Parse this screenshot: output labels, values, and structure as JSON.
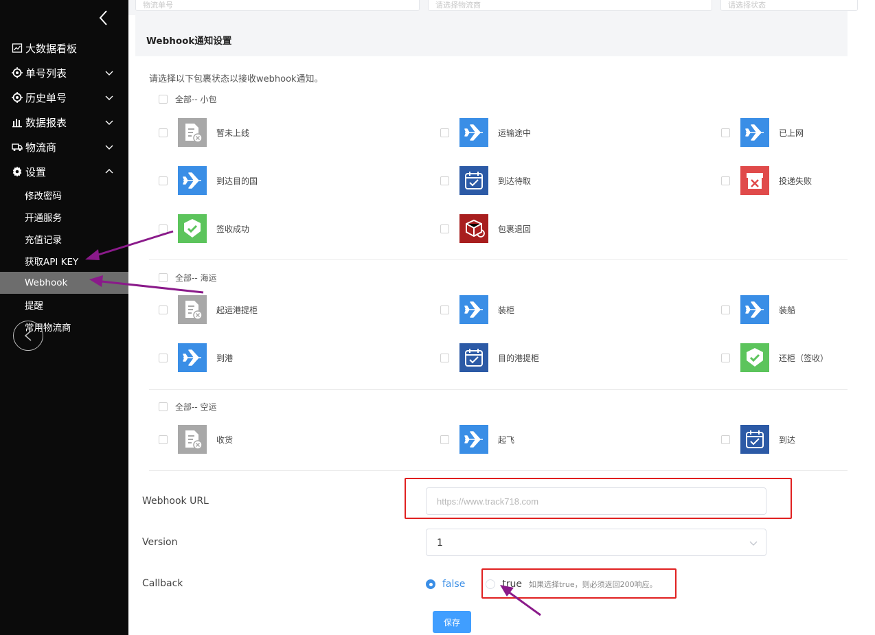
{
  "sidebar": {
    "menu": [
      {
        "label": "大数据看板",
        "icon": "chart-line-icon"
      },
      {
        "label": "单号列表",
        "icon": "target-icon"
      },
      {
        "label": "历史单号",
        "icon": "target-icon"
      },
      {
        "label": "数据报表",
        "icon": "bar-chart-icon"
      },
      {
        "label": "物流商",
        "icon": "truck-icon"
      },
      {
        "label": "设置",
        "icon": "gear-icon"
      }
    ],
    "settings_sub": [
      "修改密码",
      "开通服务",
      "充值记录",
      "获取API KEY",
      "Webhook",
      "提醒",
      "常用物流商"
    ],
    "active": "Webhook"
  },
  "top_filters": [
    "物流单号",
    "请选择物流商",
    "请选择状态"
  ],
  "webhook": {
    "title": "Webhook通知设置",
    "description": "请选择以下包裹状态以接收webhook通知。",
    "groups": [
      {
        "all_label": "全部-- 小包",
        "items": [
          {
            "label": "暂未上线",
            "icon": "document-x-icon"
          },
          {
            "label": "运输途中",
            "icon": "airplane-icon"
          },
          {
            "label": "已上网",
            "icon": "airplane-icon"
          },
          {
            "label": "到达目的国",
            "icon": "airplane-icon"
          },
          {
            "label": "到达待取",
            "icon": "calendar-check-icon"
          },
          {
            "label": "投递失败",
            "icon": "box-x-icon"
          },
          {
            "label": "签收成功",
            "icon": "shield-check-icon"
          },
          {
            "label": "包裹退回",
            "icon": "box-return-icon"
          }
        ]
      },
      {
        "all_label": "全部-- 海运",
        "items": [
          {
            "label": "起运港提柜",
            "icon": "document-x-icon"
          },
          {
            "label": "装柜",
            "icon": "airplane-icon"
          },
          {
            "label": "装船",
            "icon": "airplane-icon"
          },
          {
            "label": "到港",
            "icon": "airplane-icon"
          },
          {
            "label": "目的港提柜",
            "icon": "calendar-check-icon"
          },
          {
            "label": "还柜（签收）",
            "icon": "shield-check-icon"
          }
        ]
      },
      {
        "all_label": "全部-- 空运",
        "items": [
          {
            "label": "收货",
            "icon": "document-x-icon"
          },
          {
            "label": "起飞",
            "icon": "airplane-icon"
          },
          {
            "label": "到达",
            "icon": "calendar-check-icon"
          }
        ]
      }
    ],
    "url_label": "Webhook URL",
    "url_placeholder": "https://www.track718.com",
    "version_label": "Version",
    "version_value": "1",
    "callback_label": "Callback",
    "callback_false": "false",
    "callback_true": "true",
    "callback_hint": "如果选择true，则必须返回200响应。",
    "callback_selected": "false",
    "save_label": "保存"
  },
  "colors": {
    "sidebar_bg": "#0b0b0b",
    "active_item_bg": "#6d6d6d",
    "primary": "#409eff",
    "annotation_red": "#e02020",
    "annotation_arrow": "#8a1a8a"
  }
}
